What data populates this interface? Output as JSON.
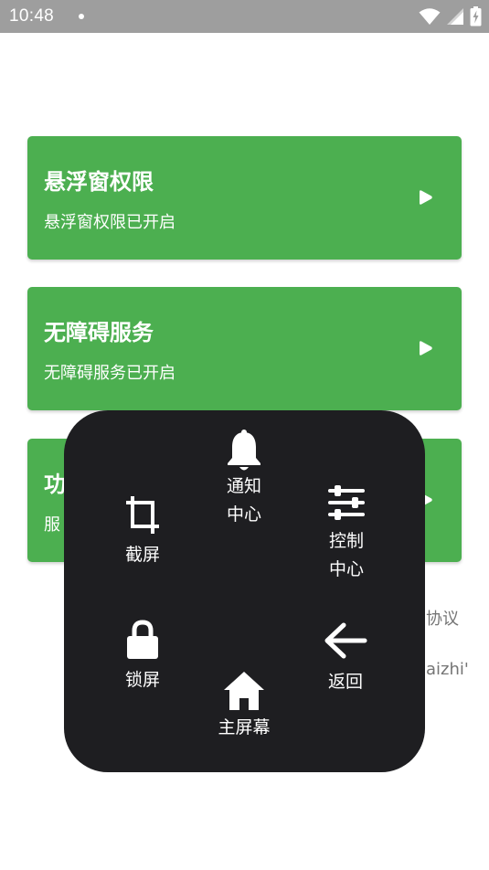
{
  "status_bar": {
    "time": "10:48",
    "icons": [
      "wifi-icon",
      "signal-icon",
      "battery-charging-icon"
    ]
  },
  "cards": [
    {
      "title": "悬浮窗权限",
      "subtitle": "悬浮窗权限已开启"
    },
    {
      "title": "无障碍服务",
      "subtitle": "无障碍服务已开启"
    },
    {
      "title": "功",
      "subtitle": "服"
    }
  ],
  "background_text": {
    "agreement_fragment": "协议",
    "pinyin_fragment": "aizhi'"
  },
  "float_menu": {
    "notification": {
      "label": "通知\n中心",
      "icon": "bell-icon"
    },
    "screenshot": {
      "label": "截屏",
      "icon": "crop-icon"
    },
    "control": {
      "label": "控制\n中心",
      "icon": "sliders-icon"
    },
    "lock": {
      "label": "锁屏",
      "icon": "lock-icon"
    },
    "back": {
      "label": "返回",
      "icon": "arrow-left-icon"
    },
    "home": {
      "label": "主屏幕",
      "icon": "home-icon"
    }
  },
  "colors": {
    "status_bar": "#9e9e9e",
    "card_green": "#4caf50",
    "menu_background": "#1e1e21"
  }
}
